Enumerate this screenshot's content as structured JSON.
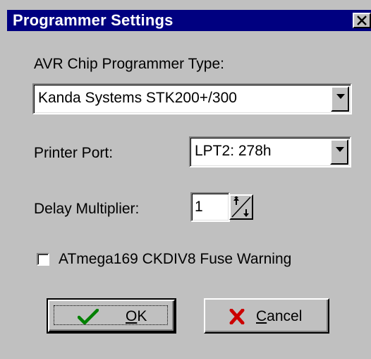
{
  "window": {
    "title": "Programmer Settings",
    "close_icon": "close-icon"
  },
  "programmer_type": {
    "label": "AVR Chip Programmer Type:",
    "selected": "Kanda Systems STK200+/300"
  },
  "printer_port": {
    "label": "Printer Port:",
    "selected": "LPT2: 278h"
  },
  "delay_multiplier": {
    "label": "Delay Multiplier:",
    "value": "1"
  },
  "fuse_warning": {
    "label": "ATmega169 CKDIV8 Fuse Warning",
    "checked": false
  },
  "buttons": {
    "ok": {
      "mnemonic": "O",
      "rest": "K",
      "icon": "checkmark-icon"
    },
    "cancel": {
      "mnemonic": "C",
      "rest": "ancel",
      "icon": "red-x-icon"
    }
  },
  "colors": {
    "titlebar": "#000080",
    "face": "#c0c0c0",
    "ok_check": "#008000",
    "cancel_x": "#cc0000"
  }
}
